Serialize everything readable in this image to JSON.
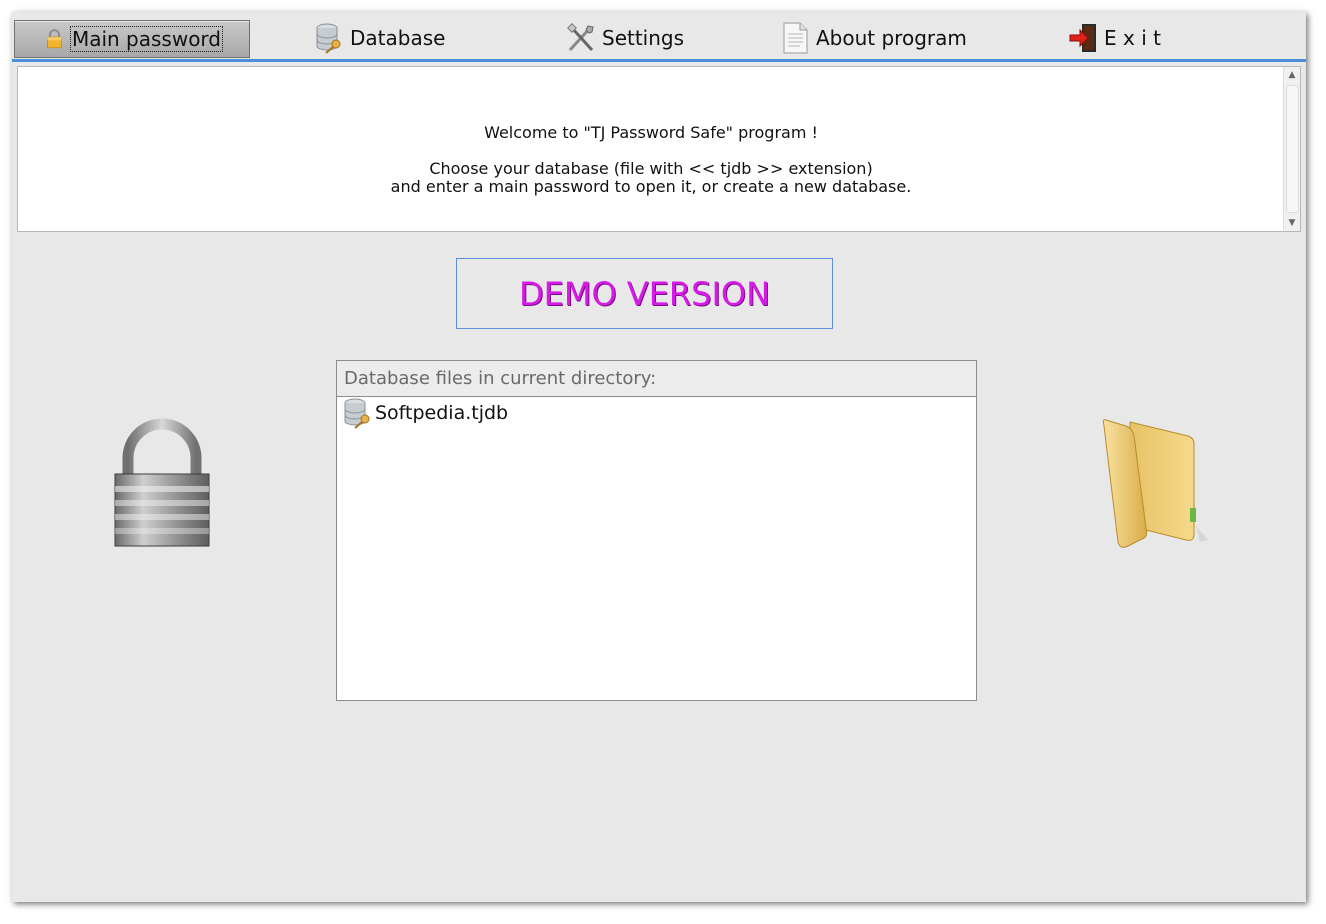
{
  "toolbar": {
    "items": [
      {
        "label": "Main password",
        "icon": "padlock-icon",
        "active": true
      },
      {
        "label": "Database",
        "icon": "database-key-icon"
      },
      {
        "label": "Settings",
        "icon": "tools-icon"
      },
      {
        "label": "About program",
        "icon": "document-icon"
      },
      {
        "label": "E x i t",
        "icon": "exit-door-icon"
      }
    ]
  },
  "message": {
    "line1": "Welcome to \"TJ Password Safe\" program !",
    "line2": "Choose your database (file with << tjdb >> extension)",
    "line3": "and enter a main password to open it, or create a new database."
  },
  "demo_label": "DEMO VERSION",
  "file_list": {
    "header": "Database files in current directory:",
    "files": [
      "Softpedia.tjdb"
    ]
  },
  "colors": {
    "accent": "#4a90d9",
    "demo_text": "#d61be6",
    "window_bg": "#e8e8e8"
  }
}
